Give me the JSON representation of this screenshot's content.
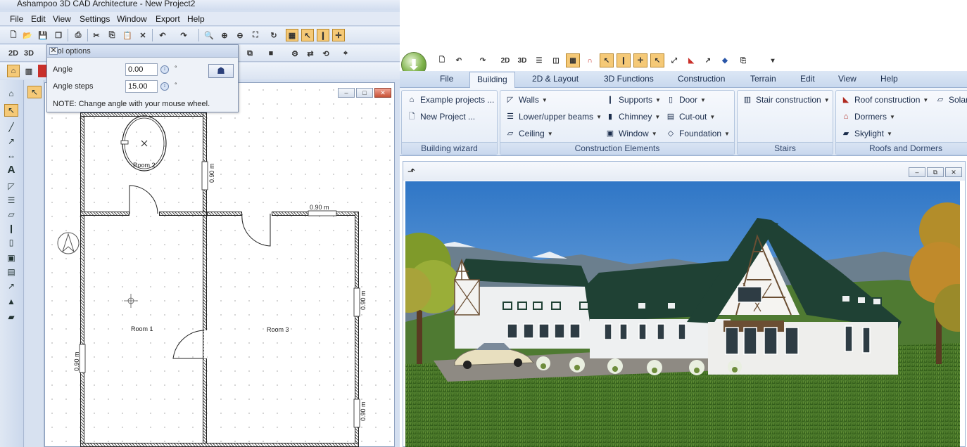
{
  "left_window": {
    "title": "Ashampoo 3D CAD Architecture - New Project2",
    "menu": [
      "File",
      "Edit",
      "View",
      "Settings",
      "Window",
      "Export",
      "Help"
    ],
    "toolbar2": {
      "btn_2d": "2D",
      "btn_3d": "3D"
    },
    "tool_options": {
      "title": "Tool options",
      "angle_label": "Angle",
      "angle_value": "0.00",
      "angle_steps_label": "Angle steps",
      "angle_steps_value": "15.00",
      "unit": "°",
      "note": "NOTE: Change angle with your mouse wheel."
    },
    "plan": {
      "rooms": [
        "Room 1",
        "Room 2",
        "Room 3"
      ],
      "dimensions": [
        "0.90 m",
        "0.90 m",
        "0.90 m",
        "0.90 m",
        "0.90 m"
      ]
    }
  },
  "right_window": {
    "quick_access": {
      "btn_2d": "2D",
      "btn_3d": "3D"
    },
    "tabs": [
      "File",
      "Building",
      "2D & Layout",
      "3D Functions",
      "Construction",
      "Terrain",
      "Edit",
      "View",
      "Help"
    ],
    "active_tab": "Building",
    "groups": {
      "wizard": {
        "title": "Building wizard",
        "items": [
          "Example projects ...",
          "New Project ..."
        ]
      },
      "elements": {
        "title": "Construction Elements",
        "items": [
          "Walls",
          "Lower/upper beams",
          "Ceiling",
          "Supports",
          "Chimney",
          "Window",
          "Door",
          "Cut-out",
          "Foundation"
        ]
      },
      "stairs": {
        "title": "Stairs",
        "items": [
          "Stair construction"
        ]
      },
      "roofs": {
        "title": "Roofs and Dormers",
        "items": [
          "Roof construction",
          "Dormers",
          "Skylight",
          "Solar"
        ]
      }
    }
  }
}
